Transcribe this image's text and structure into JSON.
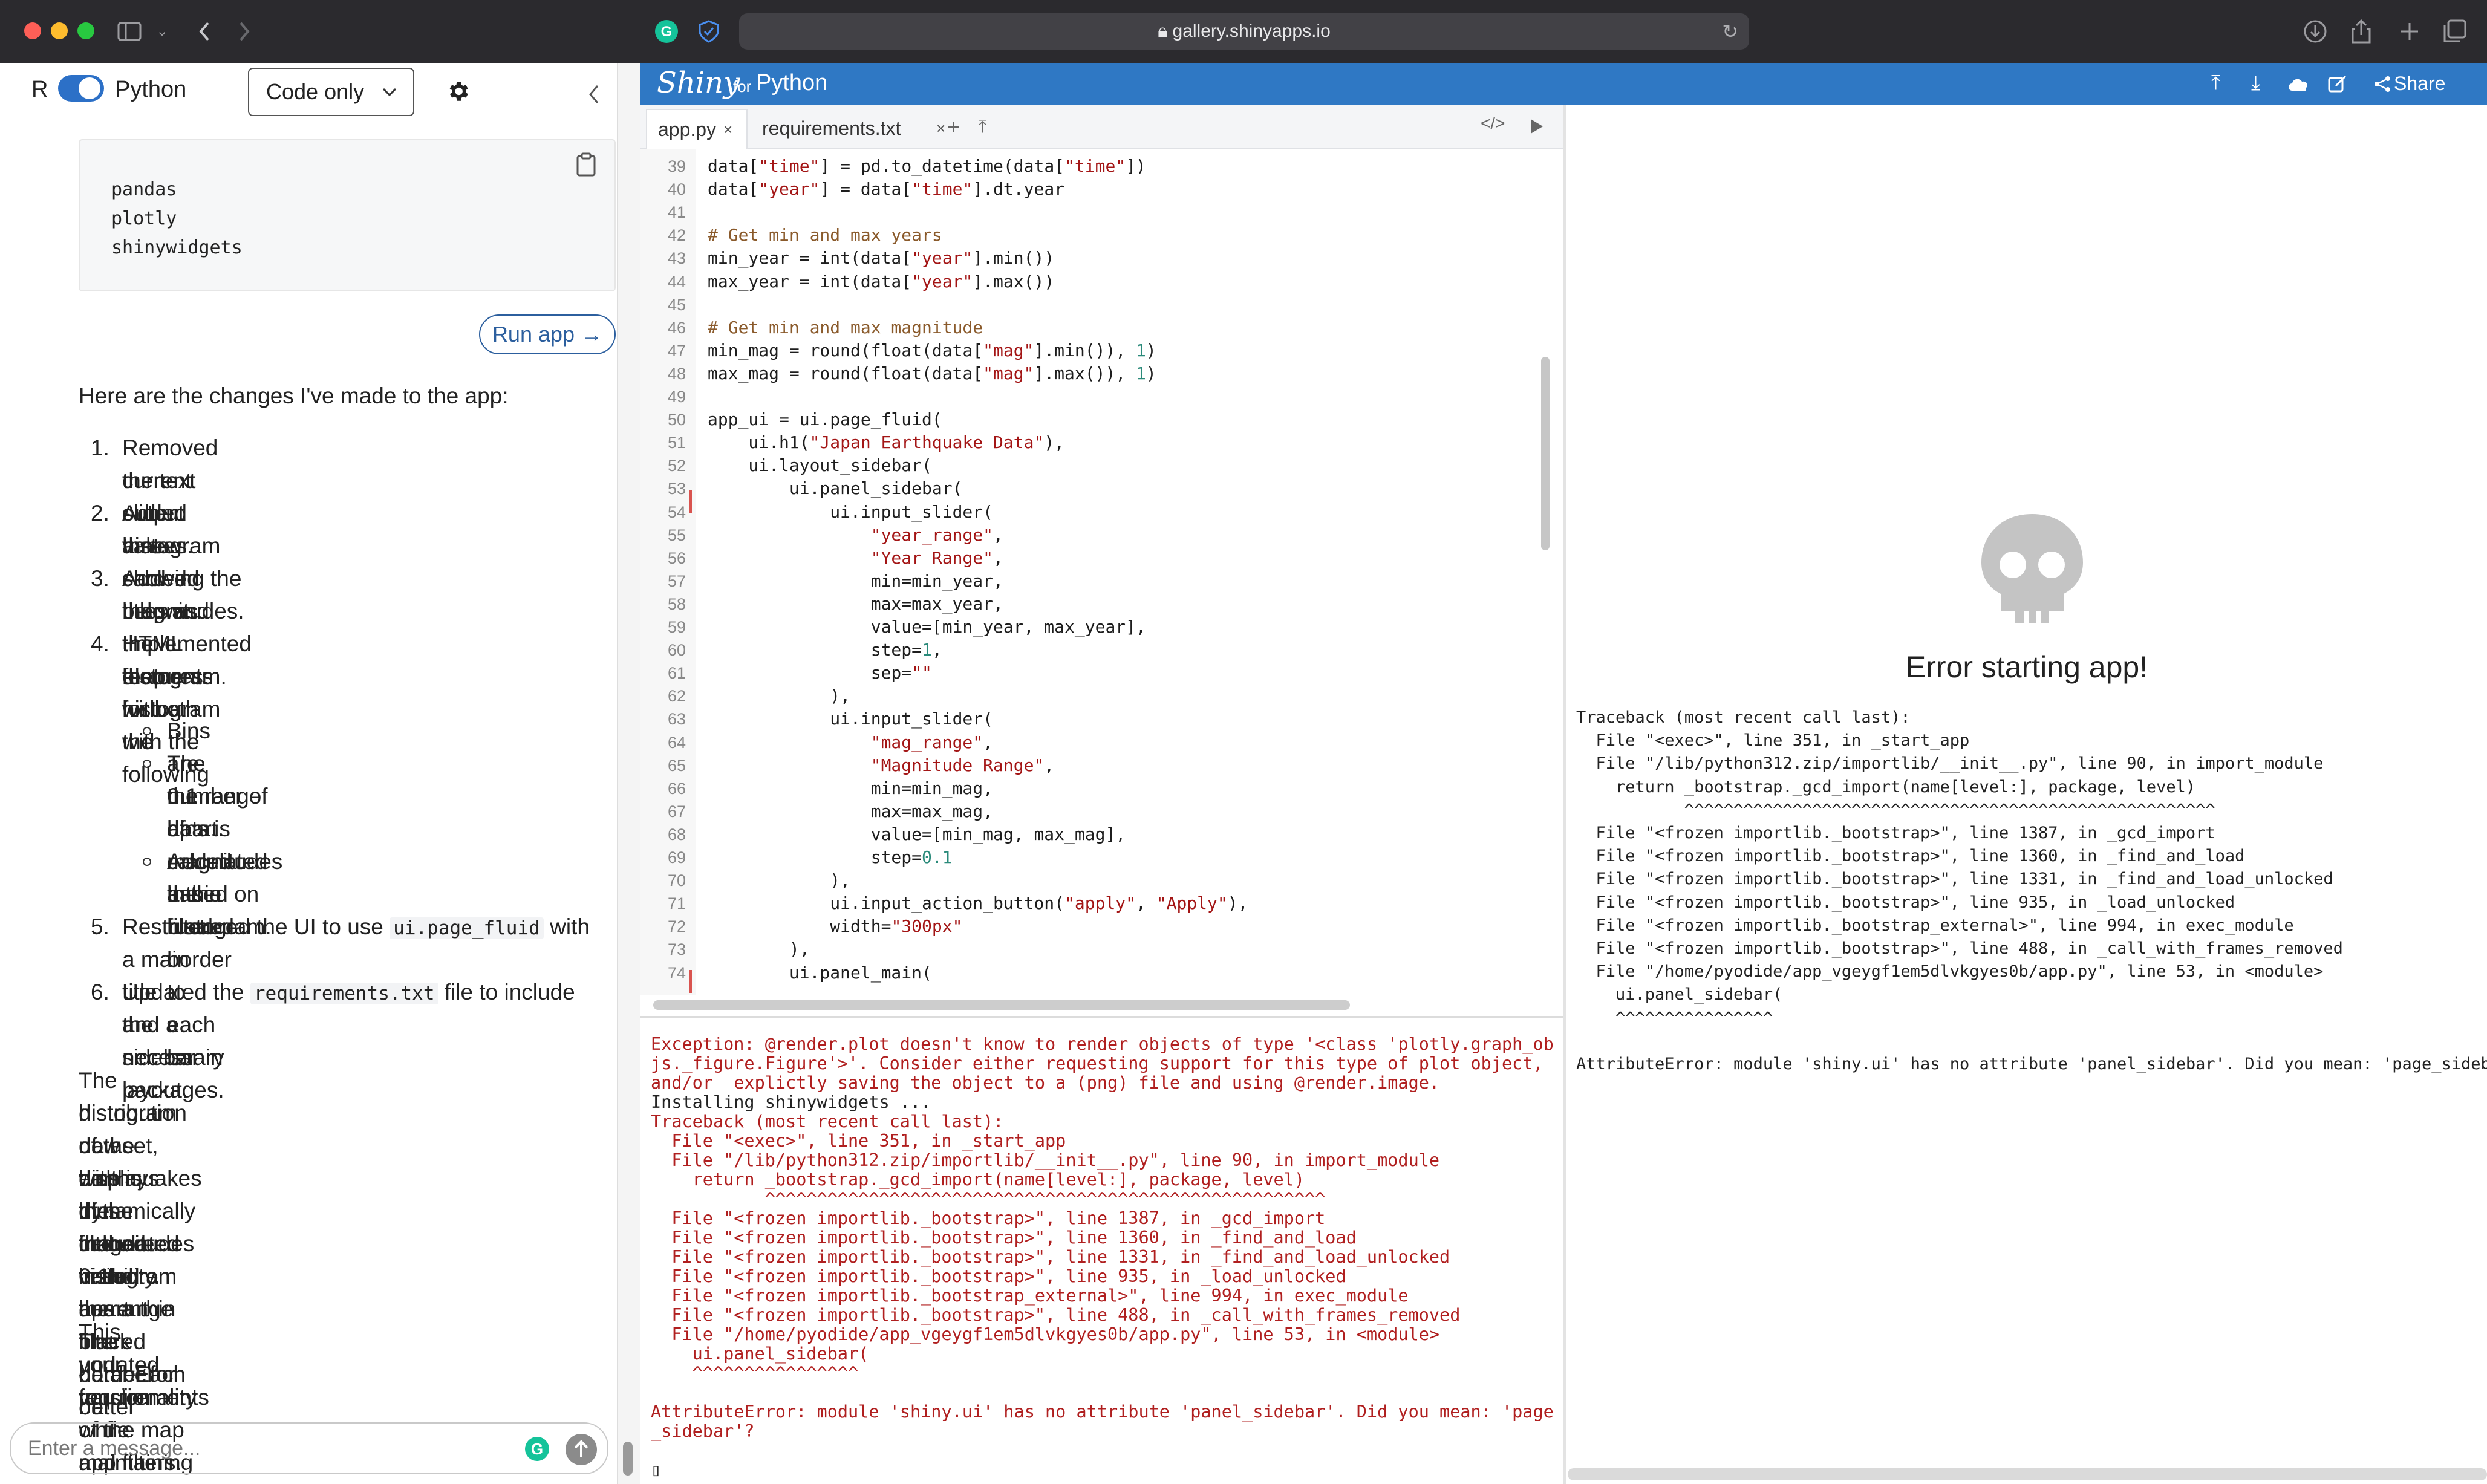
{
  "browser": {
    "url": "gallery.shinyapps.io",
    "icons": [
      "sidebar-icon",
      "back-icon",
      "forward-icon",
      "grammarly-icon",
      "shield-icon",
      "lock-icon",
      "reload-icon",
      "download-icon",
      "share-icon",
      "new-tab-icon",
      "tabs-icon"
    ]
  },
  "chat": {
    "lang_r": "R",
    "lang_python": "Python",
    "mode": "Code only",
    "code_lines": [
      "pandas",
      "plotly",
      "shinywidgets"
    ],
    "run_app": "Run app →",
    "intro": "Here are the changes I've made to the app:",
    "items": [
      {
        "n": "1.",
        "lines": [
          "Removed the text output that showed the",
          "current slider values."
        ]
      },
      {
        "n": "2.",
        "lines": [
          "Added a new card below the map with a",
          "histogram showing the magnitudes."
        ]
      },
      {
        "n": "3.",
        "lines": [
          "Added titles as HTML elements for both the",
          "map and the histogram."
        ]
      },
      {
        "n": "4.",
        "lines": [
          "Implemented the histogram with the following",
          "features:"
        ]
      }
    ],
    "subitems": [
      {
        "lines": [
          "Bins are 0.1 apart."
        ]
      },
      {
        "lines": [
          "The number of bins is calculated based on",
          "the range of magnitudes in the filtered",
          "data."
        ]
      },
      {
        "lines": [
          "Added a thin black border to each bar in",
          "the histogram."
        ]
      }
    ],
    "item5": {
      "n": "5.",
      "pre": "Restructured the UI to use ",
      "code": "ui.page_fluid",
      "post": " with",
      "line2": "a main title and a sidebar layout."
    },
    "item6": {
      "n": "6.",
      "pre": "Updated the ",
      "code": "requirements.txt",
      "post": " file to include",
      "line2": "the necessary packages."
    },
    "para1": [
      "The histogram now displays the magnitude",
      "distribution of the earthquakes in the filtered",
      "dataset, with bins that are 0.1 apart. The number of",
      "bins is dynamically calculated based on the range",
      "of magnitudes in the current filtered data. Each bar",
      "in the histogram has a thin black border for better",
      "visibility."
    ],
    "para2": [
      "This updated version of the app should meet all",
      "your requirements while maintaining the",
      "functionality of the map and filters."
    ],
    "placeholder": "Enter a message..."
  },
  "shiny": {
    "logo": "Shiny",
    "for": "for",
    "python": "Python",
    "share": "Share",
    "tabs": [
      "app.py",
      "requirements.txt"
    ]
  },
  "editor": {
    "first_line": 39,
    "lines": [
      "data[\"time\"] = pd.to_datetime(data[\"time\"])",
      "data[\"year\"] = data[\"time\"].dt.year",
      "",
      "# Get min and max years",
      "min_year = int(data[\"year\"].min())",
      "max_year = int(data[\"year\"].max())",
      "",
      "# Get min and max magnitude",
      "min_mag = round(float(data[\"mag\"].min()), 1)",
      "max_mag = round(float(data[\"mag\"].max()), 1)",
      "",
      "app_ui = ui.page_fluid(",
      "    ui.h1(\"Japan Earthquake Data\"),",
      "    ui.layout_sidebar(",
      "        ui.panel_sidebar(",
      "            ui.input_slider(",
      "                \"year_range\",",
      "                \"Year Range\",",
      "                min=min_year,",
      "                max=max_year,",
      "                value=[min_year, max_year],",
      "                step=1,",
      "                sep=\"\"",
      "            ),",
      "            ui.input_slider(",
      "                \"mag_range\",",
      "                \"Magnitude Range\",",
      "                min=min_mag,",
      "                max=max_mag,",
      "                value=[min_mag, max_mag],",
      "                step=0.1",
      "            ),",
      "            ui.input_action_button(\"apply\", \"Apply\"),",
      "            width=\"300px\"",
      "        ),",
      "        ui.panel_main("
    ]
  },
  "console": {
    "lines": [
      "Exception: @render.plot doesn't know to render objects of type '<class 'plotly.graph_ob",
      "js._figure.Figure'>'. Consider either requesting support for this type of plot object,",
      "and/or  explictly saving the object to a (png) file and using @render.image.",
      "Installing shinywidgets ...",
      "Traceback (most recent call last):",
      "  File \"<exec>\", line 351, in _start_app",
      "  File \"/lib/python312.zip/importlib/__init__.py\", line 90, in import_module",
      "    return _bootstrap._gcd_import(name[level:], package, level)",
      "           ^^^^^^^^^^^^^^^^^^^^^^^^^^^^^^^^^^^^^^^^^^^^^^^^^^^^^^",
      "  File \"<frozen importlib._bootstrap>\", line 1387, in _gcd_import",
      "  File \"<frozen importlib._bootstrap>\", line 1360, in _find_and_load",
      "  File \"<frozen importlib._bootstrap>\", line 1331, in _find_and_load_unlocked",
      "  File \"<frozen importlib._bootstrap>\", line 935, in _load_unlocked",
      "  File \"<frozen importlib._bootstrap_external>\", line 994, in exec_module",
      "  File \"<frozen importlib._bootstrap>\", line 488, in _call_with_frames_removed",
      "  File \"/home/pyodide/app_vgeygf1em5dlvkgyes0b/app.py\", line 53, in <module>",
      "    ui.panel_sidebar(",
      "    ^^^^^^^^^^^^^^^^",
      "",
      "AttributeError: module 'shiny.ui' has no attribute 'panel_sidebar'. Did you mean: 'page",
      "_sidebar'?",
      "",
      "▯"
    ]
  },
  "preview": {
    "title": "Error starting app!",
    "lines": [
      "Traceback (most recent call last):",
      "  File \"<exec>\", line 351, in _start_app",
      "  File \"/lib/python312.zip/importlib/__init__.py\", line 90, in import_module",
      "    return _bootstrap._gcd_import(name[level:], package, level)",
      "           ^^^^^^^^^^^^^^^^^^^^^^^^^^^^^^^^^^^^^^^^^^^^^^^^^^^^^^",
      "  File \"<frozen importlib._bootstrap>\", line 1387, in _gcd_import",
      "  File \"<frozen importlib._bootstrap>\", line 1360, in _find_and_load",
      "  File \"<frozen importlib._bootstrap>\", line 1331, in _find_and_load_unlocked",
      "  File \"<frozen importlib._bootstrap>\", line 935, in _load_unlocked",
      "  File \"<frozen importlib._bootstrap_external>\", line 994, in exec_module",
      "  File \"<frozen importlib._bootstrap>\", line 488, in _call_with_frames_removed",
      "  File \"/home/pyodide/app_vgeygf1em5dlvkgyes0b/app.py\", line 53, in <module>",
      "    ui.panel_sidebar(",
      "    ^^^^^^^^^^^^^^^^",
      "",
      "AttributeError: module 'shiny.ui' has no attribute 'panel_sidebar'. Did you mean: 'page_sidebar'?"
    ]
  }
}
